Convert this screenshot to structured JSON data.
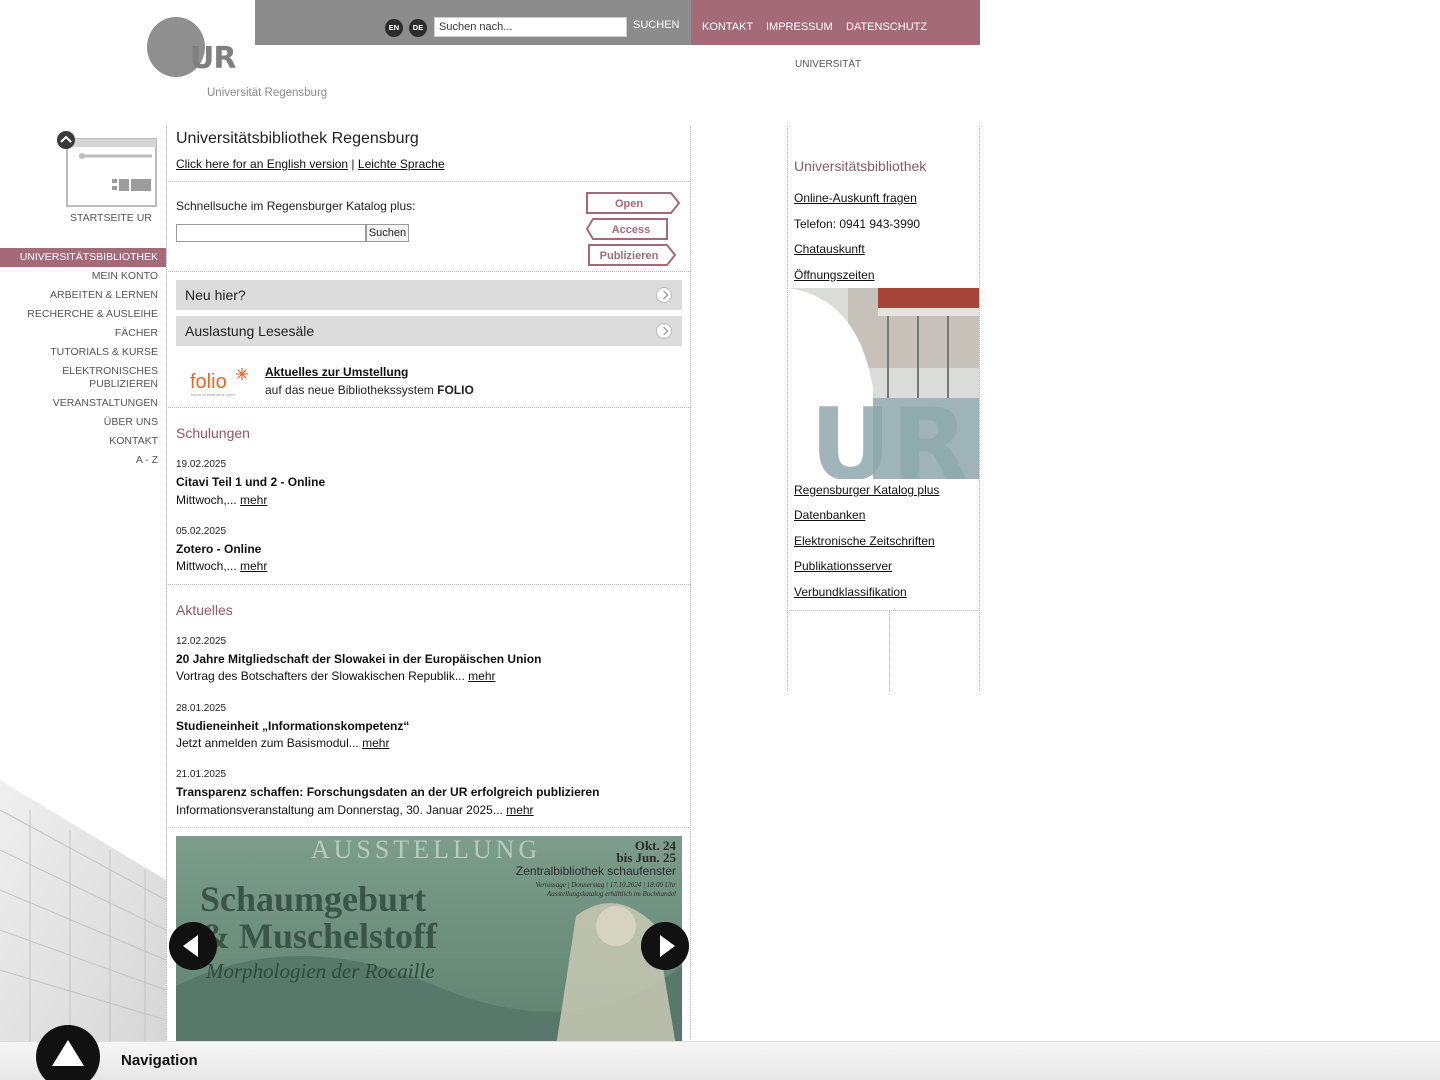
{
  "header": {
    "logo_text": "Universität Regensburg",
    "logo_letters": "UR",
    "lang_en": "EN",
    "lang_de": "DE",
    "search_placeholder": "Suchen nach...",
    "search_button": "SUCHEN",
    "links": [
      "KONTAKT",
      "IMPRESSUM",
      "DATENSCHUTZ"
    ],
    "uni_label": "UNIVERSITÄT"
  },
  "sidebar": {
    "home_label": "STARTSEITE UR",
    "items": [
      {
        "label": "UNIVERSITÄTSBIBLIOTHEK",
        "active": true
      },
      {
        "label": "MEIN KONTO"
      },
      {
        "label": "ARBEITEN & LERNEN"
      },
      {
        "label": "RECHERCHE & AUSLEIHE"
      },
      {
        "label": "FÄCHER"
      },
      {
        "label": "TUTORIALS & KURSE"
      },
      {
        "label": "ELEKTRONISCHES PUBLIZIEREN"
      },
      {
        "label": "VERANSTALTUNGEN"
      },
      {
        "label": "ÜBER UNS"
      },
      {
        "label": "KONTAKT"
      },
      {
        "label": "A - Z"
      }
    ]
  },
  "main": {
    "title": "Universitätsbibliothek Regensburg",
    "english_link": "Click here for an English version",
    "separator": "|",
    "easy_link": "Leichte Sprache",
    "quick_label": "Schnellsuche im Regensburger Katalog plus:",
    "quick_button": "Suchen",
    "oa_words": [
      "Open",
      "Access",
      "Publizieren"
    ],
    "accordions": [
      "Neu hier?",
      "Auslastung Lesesäle"
    ],
    "folio": {
      "logo": "folio",
      "logo_tagline": "future of libraries is open",
      "title": "Aktuelles zur Umstellung",
      "subtitle_prefix": "auf das neue Bibliothekssystem ",
      "subtitle_bold": "FOLIO"
    },
    "schulungen": {
      "heading": "Schulungen",
      "items": [
        {
          "date": "19.02.2025",
          "title": "Citavi Teil 1 und 2 - Online",
          "desc": "Mittwoch,... ",
          "more": "mehr"
        },
        {
          "date": "05.02.2025",
          "title": "Zotero - Online",
          "desc": "Mittwoch,... ",
          "more": "mehr"
        }
      ]
    },
    "aktuelles": {
      "heading": "Aktuelles",
      "items": [
        {
          "date": "12.02.2025",
          "title": "20 Jahre Mitgliedschaft der Slowakei in der Europäischen Union",
          "desc": "Vortrag des Botschafters der Slowakischen Republik... ",
          "more": "mehr"
        },
        {
          "date": "28.01.2025",
          "title": "Studieneinheit „Informationskompetenz“",
          "desc": "Jetzt anmelden zum Basismodul... ",
          "more": "mehr"
        },
        {
          "date": "21.01.2025",
          "title": "Transparenz schaffen: Forschungsdaten an der UR erfolgreich publizieren",
          "desc": "Informationsveranstaltung am Donnerstag, 30. Januar 2025... ",
          "more": "mehr"
        }
      ]
    },
    "banner": {
      "top": "AUSSTELLUNG",
      "dates_1": "Okt. 24",
      "dates_2": "bis Jun. 25",
      "place": "Zentralbibliothek schaufenster",
      "vernissage": "Vernissage | Donnerstag | 17.10.2024 | 18:00 Uhr",
      "katalog": "Ausstellungskatalog erhältlich im Buchhandel",
      "title_1": "Schaumgeburt",
      "title_2": "& Muschelstoff",
      "subtitle": "Morphologien der Rocaille"
    }
  },
  "right": {
    "heading": "Universitätsbibliothek",
    "contact_links": [
      "Online-Auskunft fragen",
      "Telefon: 0941 943-3990",
      "Chatauskunft",
      "Öffnungszeiten"
    ],
    "resource_links": [
      "Regensburger Katalog plus",
      "Datenbanken",
      "Elektronische Zeitschriften",
      "Publikationsserver",
      "Verbundklassifikation"
    ],
    "image_letters": "UR"
  },
  "bottom": {
    "nav_label": "Navigation"
  },
  "colors": {
    "accent": "#a46a78",
    "heading": "#8b5a67",
    "topbar_gray": "#8c8c8c"
  }
}
